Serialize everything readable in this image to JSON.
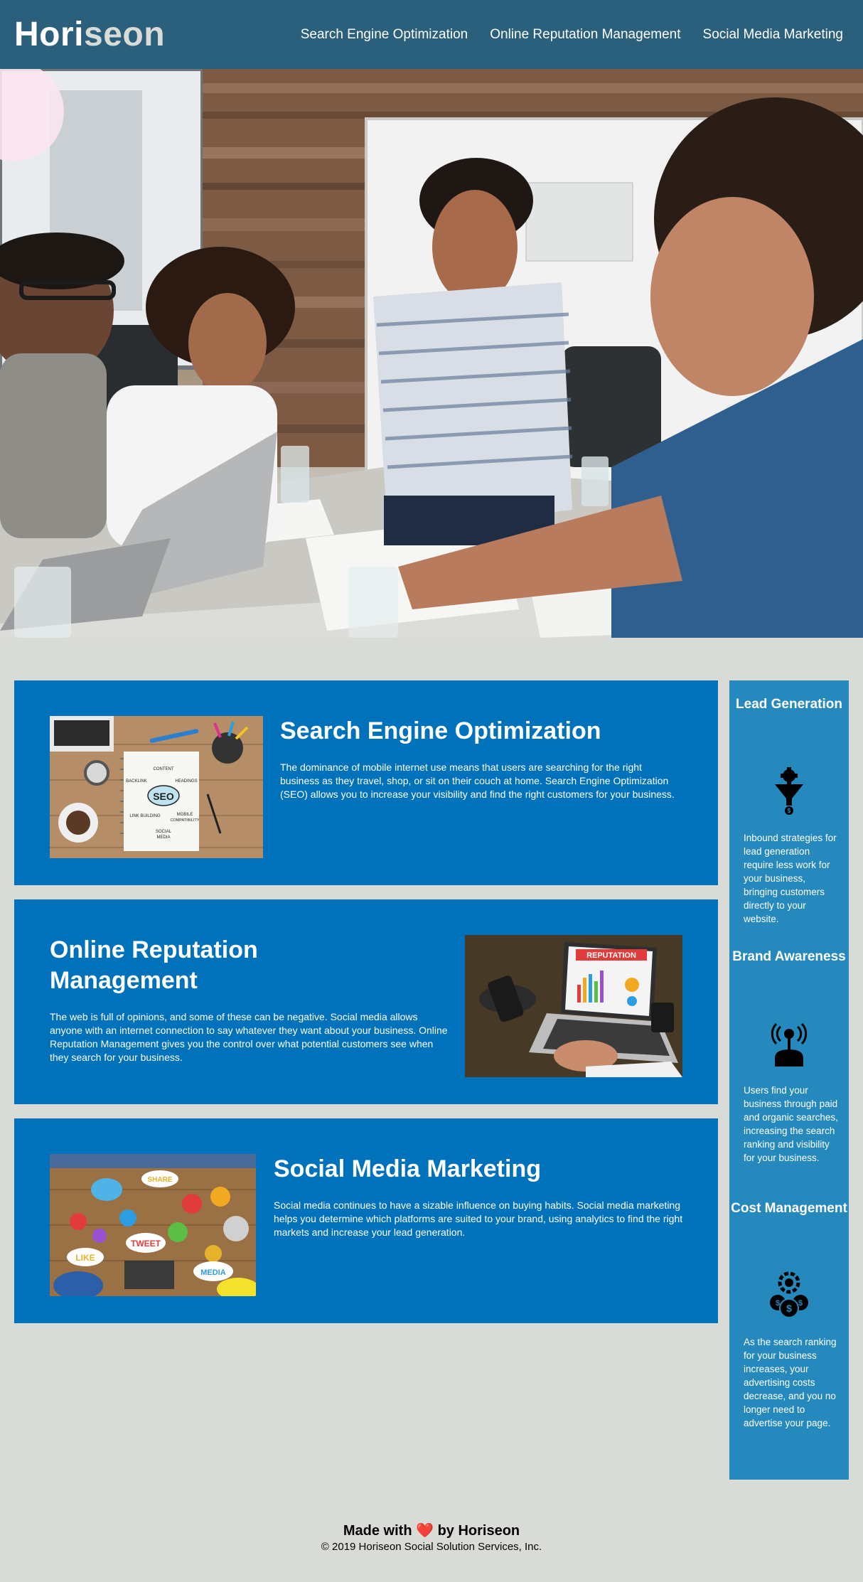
{
  "header": {
    "logo_main": "Hori",
    "logo_accent": "seon",
    "nav": [
      {
        "label": "Search Engine Optimization"
      },
      {
        "label": "Online Reputation Management"
      },
      {
        "label": "Social Media Marketing"
      }
    ]
  },
  "content": {
    "seo": {
      "title": "Search Engine Optimization",
      "body": "The dominance of mobile internet use means that users are searching for the right business as they travel, shop, or sit on their couch at home. Search Engine Optimization (SEO) allows you to increase your visibility and find the right customers for your business.",
      "image": {
        "seo": "SEO",
        "content": "CONTENT",
        "backlink": "BACKLINK",
        "headings": "HEADINGS",
        "link_building": "LINK BUILDING",
        "mobile": "MOBILE",
        "compatibility": "COMPATIBILITY",
        "social": "SOCIAL",
        "media": "MEDIA"
      }
    },
    "reputation": {
      "title": "Online Reputation Management",
      "body": "The web is full of opinions, and some of these can be negative. Social media allows anyone with an internet connection to say whatever they want about your business. Online Reputation Management gives you the control over what potential customers see when they search for your business.",
      "image": {
        "banner": "REPUTATION"
      }
    },
    "social": {
      "title": "Social Media Marketing",
      "body": "Social media continues to have a sizable influence on buying habits. Social media marketing helps you determine which platforms are suited to your brand, using analytics to find the right markets and increase your lead generation.",
      "image": {
        "share": "SHARE",
        "tweet": "TWEET",
        "like": "LIKE",
        "media": "MEDIA"
      }
    }
  },
  "benefits": [
    {
      "title": "Lead Generation",
      "icon": "lead-funnel-icon",
      "body": "Inbound strategies for lead generation require less work for your business, bringing customers directly to your website."
    },
    {
      "title": "Brand Awareness",
      "icon": "brand-broadcast-icon",
      "body": "Users find your business through paid and organic searches, increasing the search ranking and visibility for your business."
    },
    {
      "title": "Cost Management",
      "icon": "cost-coins-gear-icon",
      "body": "As the search ranking for your business increases, your advertising costs decrease, and you no longer need to advertise your page."
    }
  ],
  "footer": {
    "made_prefix": "Made with",
    "heart": "❤️",
    "made_suffix": "by Horiseon",
    "copyright": "© 2019 Horiseon Social Solution Services, Inc."
  },
  "colors": {
    "header": "#2a607c",
    "page_background": "#d9dcd6",
    "card": "#0072bb",
    "sidebar": "#2589bd",
    "logo_accent": "#d9dcd6"
  }
}
